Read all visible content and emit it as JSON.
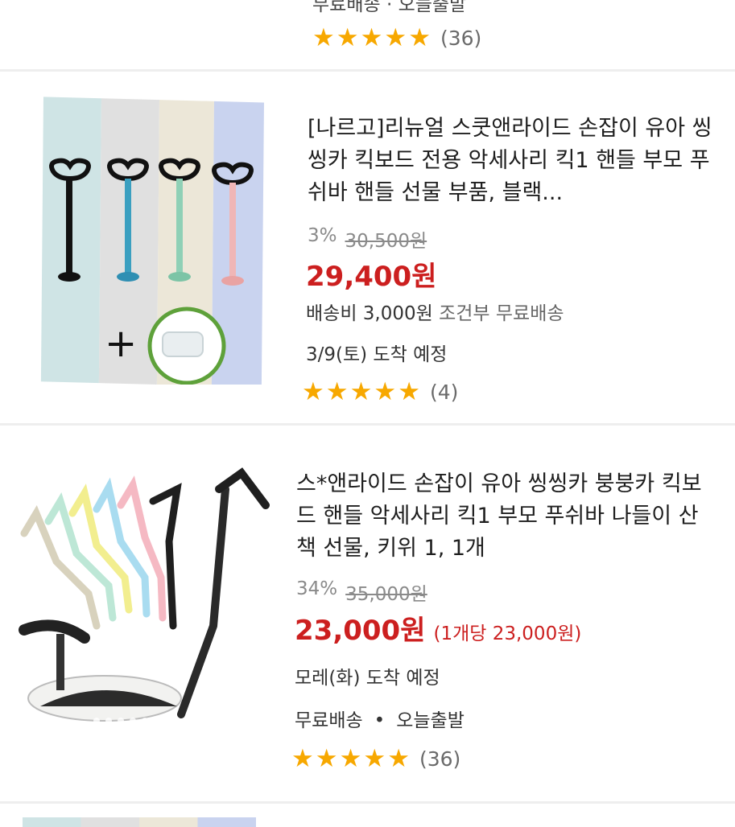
{
  "top_item": {
    "partial_text": "무료배송 · 오늘출발",
    "review_count": "(36)"
  },
  "products": [
    {
      "title": "[나르고]리뉴얼 스쿳앤라이드 손잡이 유아 씽씽카 킥보드 전용 악세사리 킥1 핸들 부모 푸쉬바 핸들 선물 부품, 블랙...",
      "discount": "3%",
      "original_price": "30,500원",
      "price": "29,400원",
      "shipping_fee": "배송비 3,000원",
      "shipping_condition": "조건부 무료배송",
      "arrival": "3/9(토) 도착 예정",
      "review_count": "(4)",
      "image_plus": "+"
    },
    {
      "title": "스*앤라이드 손잡이 유아 씽씽카 붕붕카 킥보드 핸들 악세사리 킥1 부모 푸쉬바 나들이 산책 선물, 키위 1, 1개",
      "discount": "34%",
      "original_price": "35,000원",
      "price": "23,000원",
      "unit_price": "(1개당 23,000원)",
      "arrival": "모레(화) 도착 예정",
      "delivery": "무료배송",
      "dispatch": "오늘출발",
      "separator": "•",
      "review_count": "(36)"
    }
  ],
  "rating_stars": 5,
  "colors": {
    "price": "#cc1f1f",
    "star": "#f7a800"
  }
}
